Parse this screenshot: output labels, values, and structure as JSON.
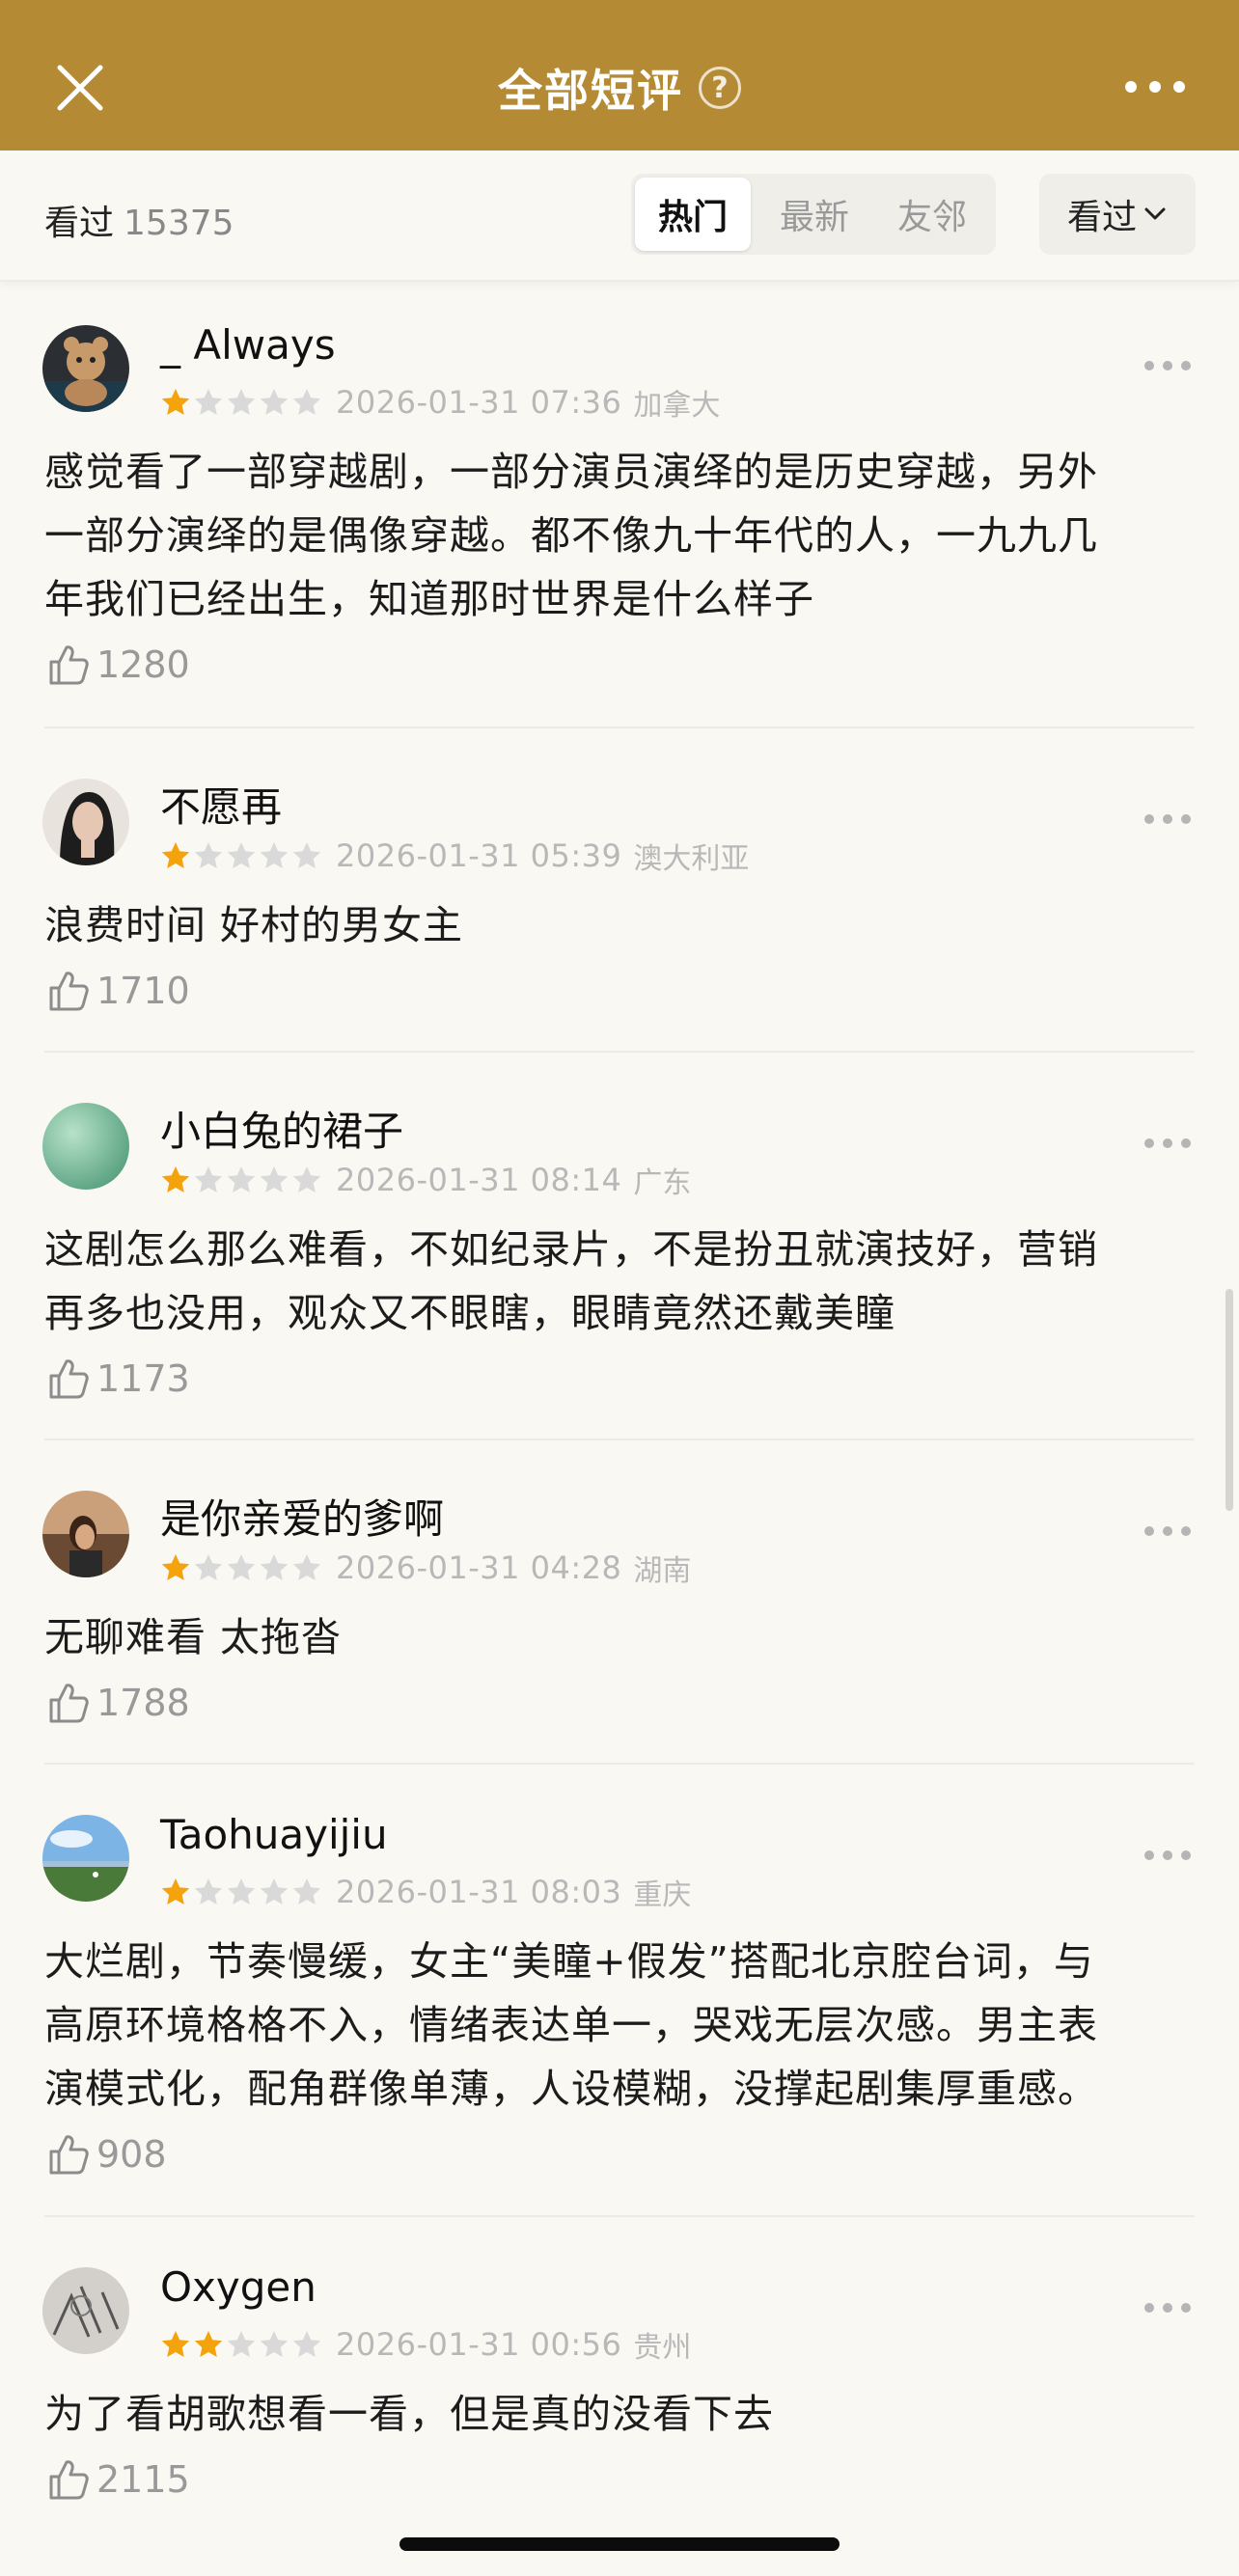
{
  "header": {
    "title": "全部短评",
    "help": "?"
  },
  "filter": {
    "count_label": "看过",
    "count_value": "15375",
    "tabs": [
      "热门",
      "最新",
      "友邻"
    ],
    "dropdown_label": "看过"
  },
  "colors": {
    "brand": "#b58a34",
    "star_on": "#f4a30c",
    "star_off": "#d9d9d9",
    "bg": "#faf8f3"
  },
  "reviews": [
    {
      "user": "_ Always",
      "rating": 1,
      "date": "2026-01-31 07:36",
      "location": "加拿大",
      "lines": [
        "感觉看了一部穿越剧，一部分演员演绎的是历史穿越，另外",
        "一部分演绎的是偶像穿越。都不像九十年代的人，一九九几",
        "年我们已经出生，知道那时世界是什么样子"
      ],
      "likes": "1280",
      "avatar": "bear-avatar"
    },
    {
      "user": "不愿再",
      "rating": 1,
      "date": "2026-01-31 05:39",
      "location": "澳大利亚",
      "lines": [
        "浪费时间 好村的男女主"
      ],
      "likes": "1710",
      "avatar": "portrait-avatar"
    },
    {
      "user": "小白兔的裙子",
      "rating": 1,
      "date": "2026-01-31 08:14",
      "location": "广东",
      "lines": [
        "这剧怎么那么难看，不如纪录片，不是扮丑就演技好，营销",
        "再多也没用，观众又不眼瞎，眼睛竟然还戴美瞳"
      ],
      "likes": "1173",
      "avatar": "green-avatar"
    },
    {
      "user": "是你亲爱的爹啊",
      "rating": 1,
      "date": "2026-01-31 04:28",
      "location": "湖南",
      "lines": [
        "无聊难看 太拖沓"
      ],
      "likes": "1788",
      "avatar": "beach-avatar"
    },
    {
      "user": "Taohuayijiu",
      "rating": 1,
      "date": "2026-01-31 08:03",
      "location": "重庆",
      "lines": [
        "大烂剧，节奏慢缓，女主“美瞳+假发”搭配北京腔台词，与",
        "高原环境格格不入，情绪表达单一，哭戏无层次感。男主表",
        "演模式化，配角群像单薄，人设模糊，没撑起剧集厚重感。"
      ],
      "likes": "908",
      "avatar": "landscape-avatar"
    },
    {
      "user": "Oxygen",
      "rating": 2,
      "date": "2026-01-31 00:56",
      "location": "贵州",
      "lines": [
        "为了看胡歌想看一看，但是真的没看下去"
      ],
      "likes": "2115",
      "avatar": "sketch-avatar"
    }
  ]
}
